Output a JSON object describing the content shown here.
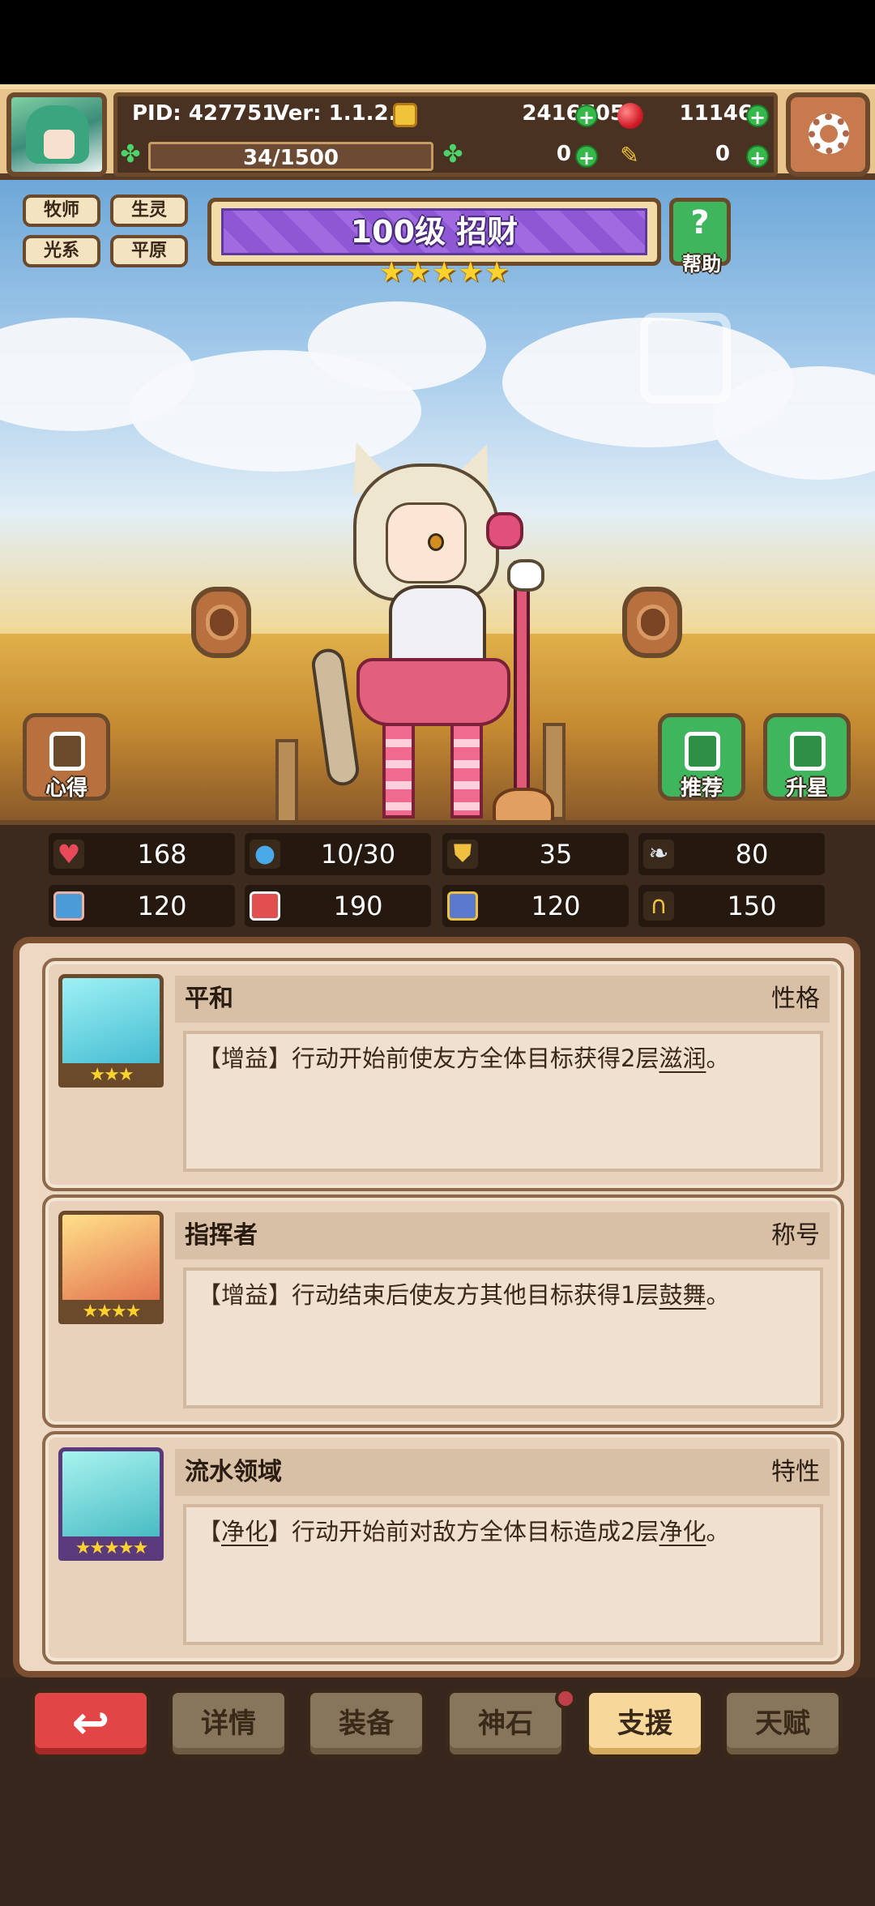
{
  "hud": {
    "pid": "PID: 427751",
    "version": "Ver: 1.1.2.5",
    "gold": "2416705",
    "ruby": "11146",
    "stamina": "34/1500",
    "clover": "0",
    "ticket": "0"
  },
  "hero": {
    "tags": [
      "牧师",
      "生灵",
      "光系",
      "平原"
    ],
    "title": "100级 招财",
    "stars": 5,
    "help_label": "帮助",
    "left_button": "心得",
    "recommend_button": "推荐",
    "star_up_button": "升星"
  },
  "stats": [
    {
      "icon": "heart-icon",
      "value": "168",
      "color": "#e84a5a"
    },
    {
      "icon": "water-drop-icon",
      "value": "10/30",
      "color": "#4aa9e8"
    },
    {
      "icon": "shield-icon",
      "value": "35",
      "color": "#f0c040"
    },
    {
      "icon": "wing-icon",
      "value": "80",
      "color": "#dfe6ee"
    },
    {
      "icon": "fist-icon",
      "value": "120",
      "color": "#f0b0a0"
    },
    {
      "icon": "book-icon",
      "value": "190",
      "color": "#e05050"
    },
    {
      "icon": "boot-icon",
      "value": "120",
      "color": "#5a7ad0"
    },
    {
      "icon": "horseshoe-icon",
      "value": "150",
      "color": "#f0c040"
    }
  ],
  "cards": [
    {
      "name": "平和",
      "type": "性格",
      "stars": "★★★",
      "desc_pre": "【增益】行动开始前使友方全体目标获得2层",
      "keyword": "滋润",
      "desc_post": "。",
      "portrait_color": "#5fd1e0",
      "frame_color": "#6b4a2c"
    },
    {
      "name": "指挥者",
      "type": "称号",
      "stars": "★★★★",
      "desc_pre": "【增益】行动结束后使友方其他目标获得1层",
      "keyword": "鼓舞",
      "desc_post": "。",
      "portrait_color": "#f0b070",
      "frame_color": "#6b4a2c"
    },
    {
      "name": "流水领域",
      "type": "特性",
      "stars": "★★★★★",
      "desc_pre": "【",
      "keyword_a": "净化",
      "desc_mid": "】行动开始前对敌方全体目标造成2层",
      "keyword": "净化",
      "desc_post": "。",
      "portrait_color": "#6fd6d9",
      "frame_color": "#5a3a7a"
    }
  ],
  "nav": {
    "back": "",
    "details": "详情",
    "equipment": "装备",
    "divine_stone": "神石",
    "support": "支援",
    "talent": "天赋"
  }
}
